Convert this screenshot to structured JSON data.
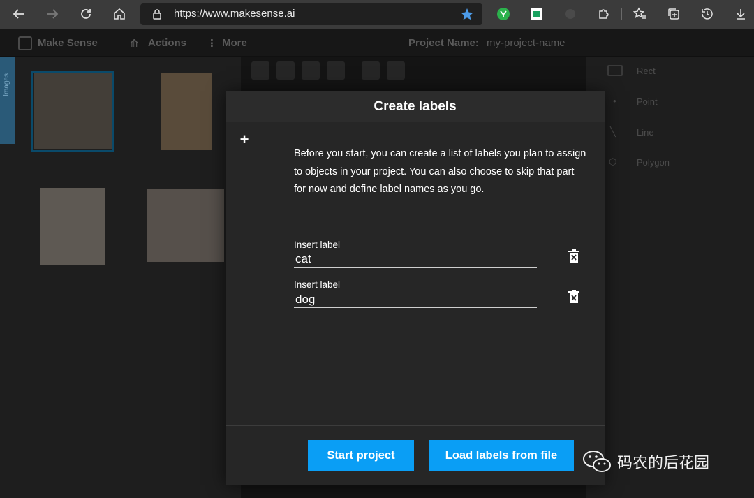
{
  "browser": {
    "url": "https://www.makesense.ai"
  },
  "app": {
    "brand": "Make Sense",
    "menu_actions": "Actions",
    "menu_more": "More",
    "project_name_label": "Project Name:",
    "project_name_value": "my-project-name",
    "left_tab_label": "Images",
    "tools": [
      "Rect",
      "Point",
      "Line",
      "Polygon"
    ]
  },
  "modal": {
    "title": "Create labels",
    "add_icon": "+",
    "description": "Before you start, you can create a list of labels you plan to assign to objects in your project. You can also choose to skip that part for now and define label names as you go.",
    "labels": [
      {
        "field_label": "Insert label",
        "value": "cat"
      },
      {
        "field_label": "Insert label",
        "value": "dog"
      }
    ],
    "start_button": "Start project",
    "load_button": "Load labels from file"
  },
  "watermark": {
    "text": "码农的后花园"
  },
  "colors": {
    "accent": "#0a9ef5",
    "modal_bg": "#262626",
    "chrome_bg": "#3b3b3b"
  }
}
